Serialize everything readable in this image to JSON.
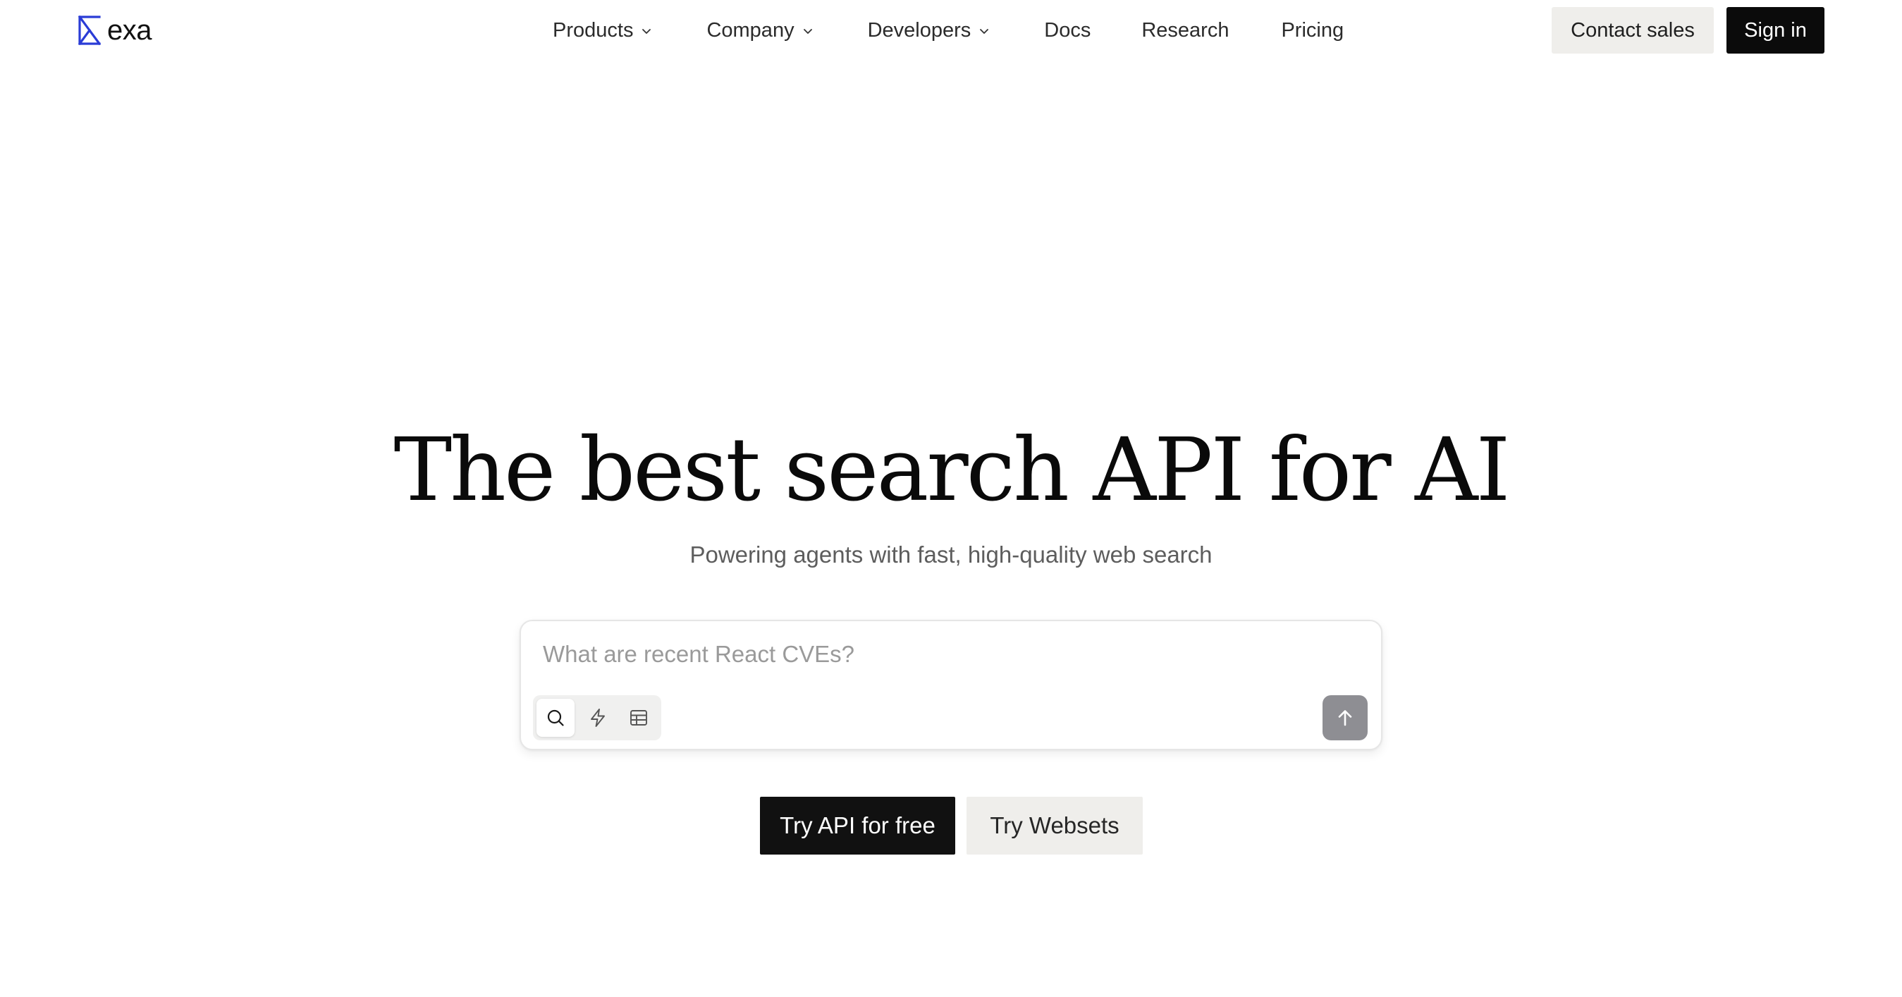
{
  "brand": {
    "name": "exa",
    "logo_icon": "exa-logo-icon",
    "accent_color": "#2a3cd6"
  },
  "nav": {
    "items": [
      {
        "label": "Products",
        "has_dropdown": true
      },
      {
        "label": "Company",
        "has_dropdown": true
      },
      {
        "label": "Developers",
        "has_dropdown": true
      },
      {
        "label": "Docs",
        "has_dropdown": false
      },
      {
        "label": "Research",
        "has_dropdown": false
      },
      {
        "label": "Pricing",
        "has_dropdown": false
      }
    ],
    "contact_label": "Contact sales",
    "signin_label": "Sign in"
  },
  "hero": {
    "title": "The best search API for AI",
    "subtitle": "Powering agents with fast, high-quality web search"
  },
  "search": {
    "placeholder": "What are recent React CVEs?",
    "value": "",
    "modes": [
      {
        "icon": "search-icon",
        "active": true
      },
      {
        "icon": "lightning-icon",
        "active": false
      },
      {
        "icon": "table-icon",
        "active": false
      }
    ],
    "submit_icon": "arrow-up-icon",
    "submit_color": "#8e8e93"
  },
  "cta": {
    "primary_label": "Try API for free",
    "secondary_label": "Try Websets"
  }
}
